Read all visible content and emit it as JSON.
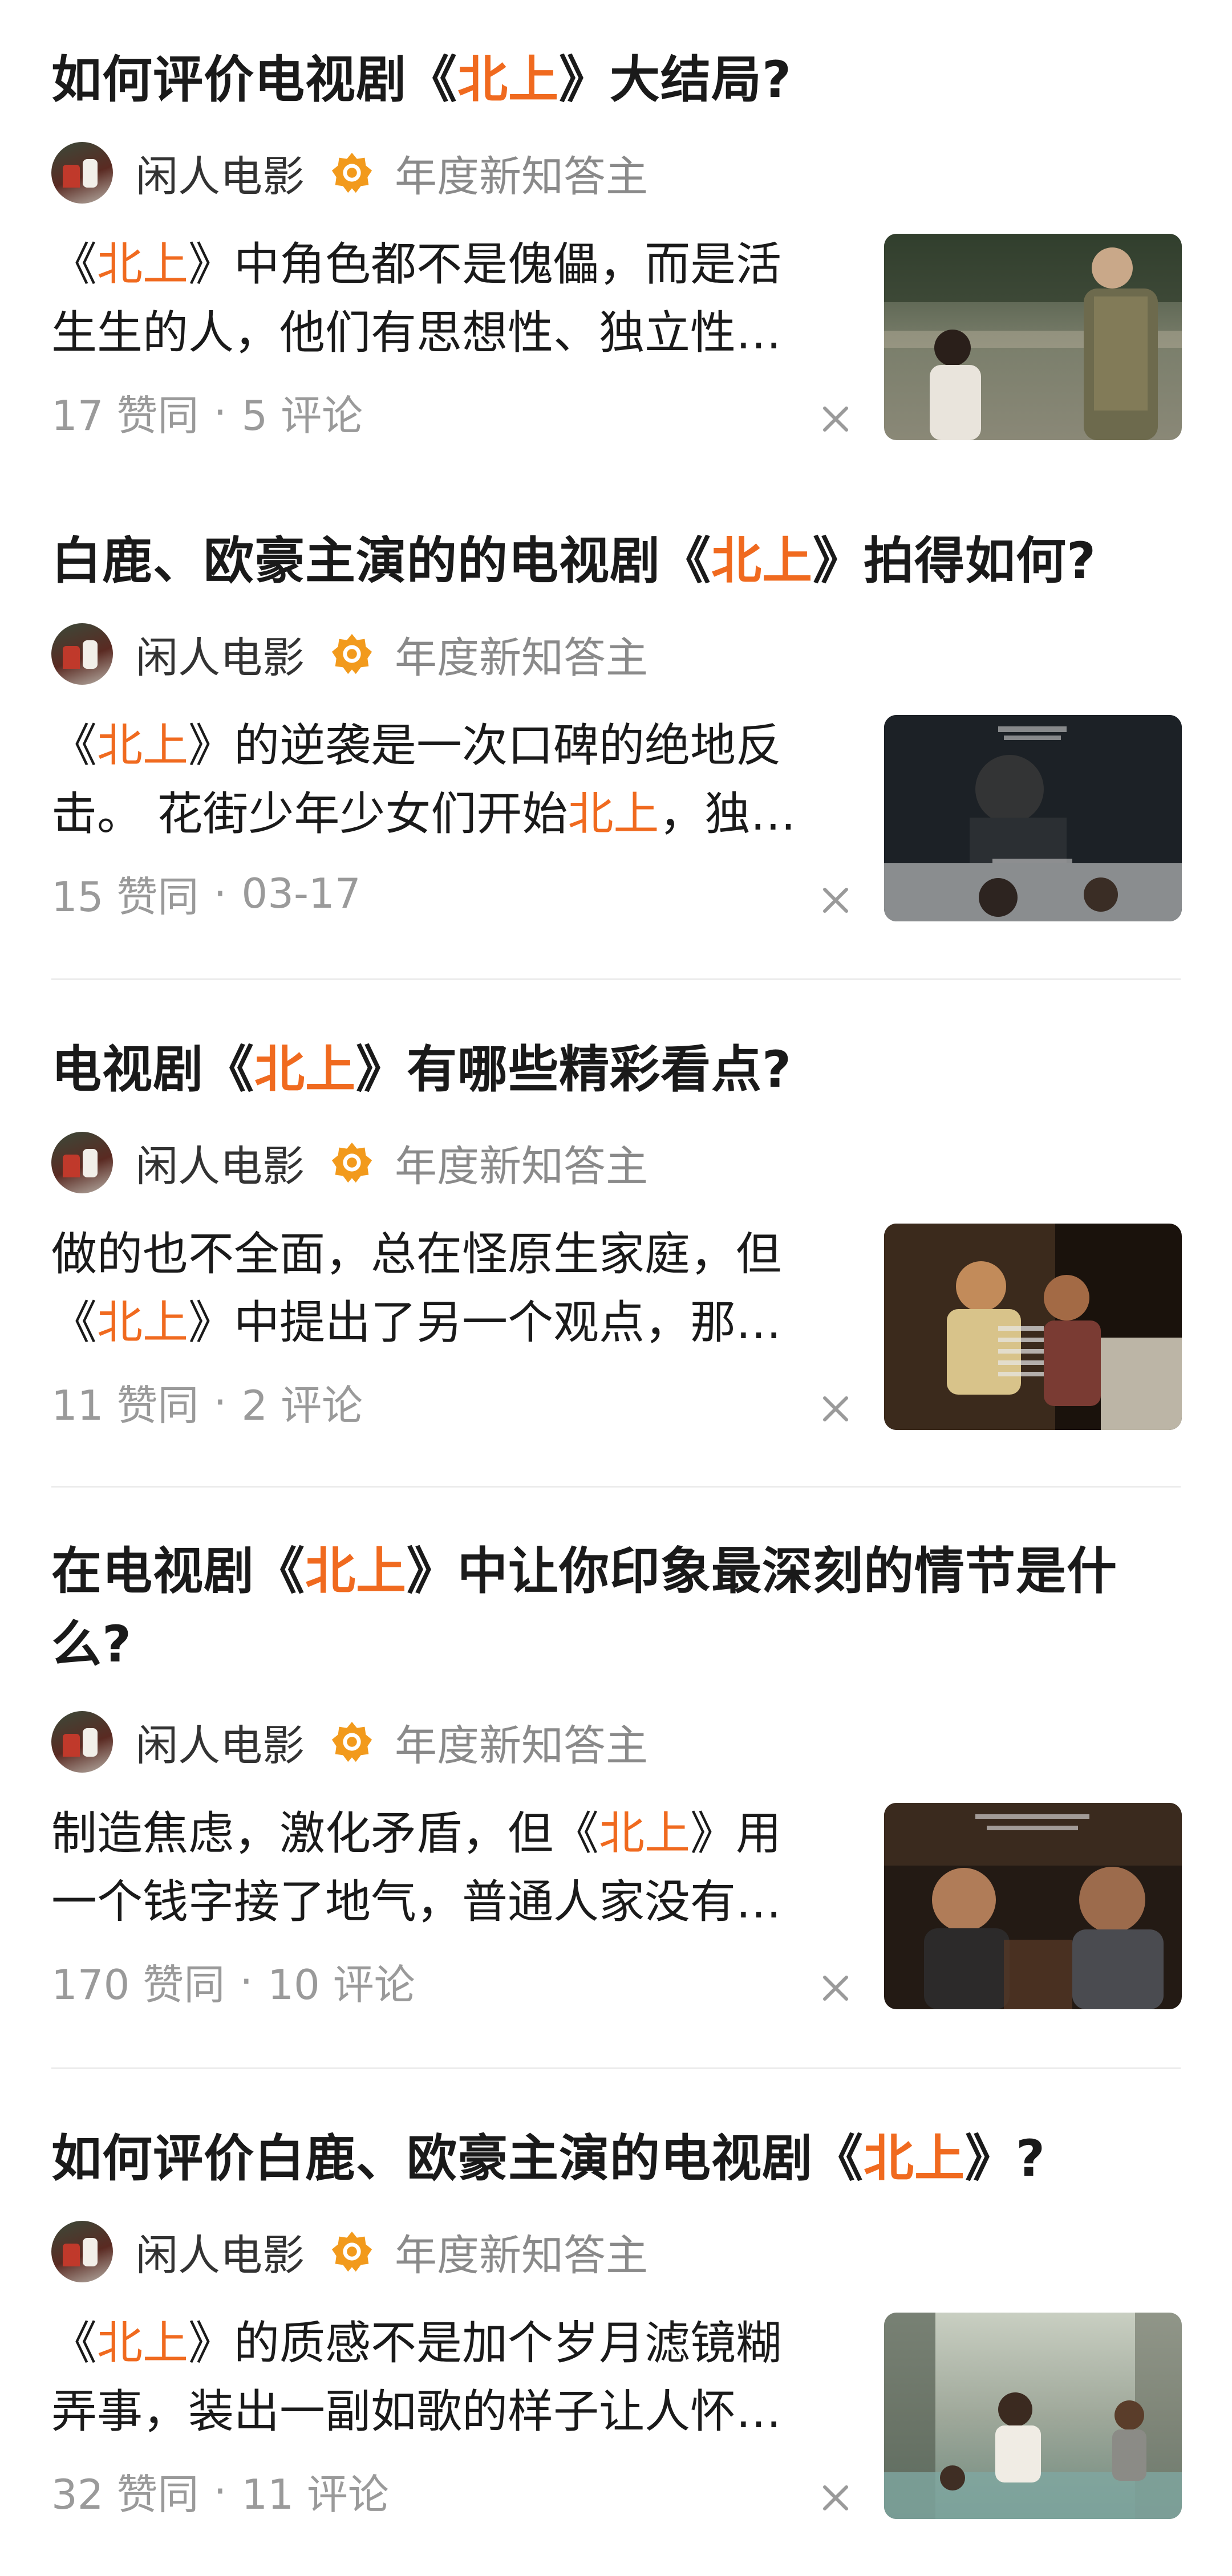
{
  "cards": [
    {
      "title_pre": "如何评价电视剧《",
      "title_hl": "北上",
      "title_post": "》大结局?",
      "author": "闲人电影",
      "badge": "年度新知答主",
      "excerpt_l1_pre": "《",
      "excerpt_l1_hl": "北上",
      "excerpt_l1_post": "》中角色都不是傀儡，而是活",
      "excerpt_l2": "生生的人，他们有思想性、独立性…",
      "likes": "17 赞同",
      "third": "5 评论"
    },
    {
      "title_pre": "白鹿、欧豪主演的的电视剧《",
      "title_hl": "北上",
      "title_post": "》拍得如何?",
      "author": "闲人电影",
      "badge": "年度新知答主",
      "excerpt_l1_pre": "《",
      "excerpt_l1_hl": "北上",
      "excerpt_l1_post": "》的逆袭是一次口碑的绝地反",
      "excerpt_l2_pre": "击。 花街少年少女们开始",
      "excerpt_l2_hl": "北上",
      "excerpt_l2_post": "，独…",
      "likes": "15 赞同",
      "third": "03-17"
    },
    {
      "title_pre": "电视剧《",
      "title_hl": "北上",
      "title_post": "》有哪些精彩看点?",
      "author": "闲人电影",
      "badge": "年度新知答主",
      "excerpt_l1": "做的也不全面，总在怪原生家庭，但",
      "excerpt_l2_pre": "《",
      "excerpt_l2_hl": "北上",
      "excerpt_l2_post": "》中提出了另一个观点，那…",
      "likes": "11 赞同",
      "third": "2 评论"
    },
    {
      "title_pre": "在电视剧《",
      "title_hl": "北上",
      "title_post": "》中让你印象最深刻的情节是什",
      "title_line2": "么?",
      "author": "闲人电影",
      "badge": "年度新知答主",
      "excerpt_l1_pre": "制造焦虑，激化矛盾，但《",
      "excerpt_l1_hl": "北上",
      "excerpt_l1_post": "》用",
      "excerpt_l2": "一个钱字接了地气，普通人家没有…",
      "likes": "170 赞同",
      "third": "10 评论"
    },
    {
      "title_pre": "如何评价白鹿、欧豪主演的电视剧《",
      "title_hl": "北上",
      "title_post": "》?",
      "author": "闲人电影",
      "badge": "年度新知答主",
      "excerpt_l1_pre": "《",
      "excerpt_l1_hl": "北上",
      "excerpt_l1_post": "》的质感不是加个岁月滤镜糊",
      "excerpt_l2": "弄事，装出一副如歌的样子让人怀…",
      "likes": "32 赞同",
      "third": "11 评论"
    }
  ],
  "meta_separator": "·",
  "colors": {
    "highlight": "#f06a1f",
    "badge": "#f29a1c",
    "muted": "#9a9a9a"
  },
  "icons": {
    "badge": "verified-badge-icon",
    "close": "close-icon"
  }
}
